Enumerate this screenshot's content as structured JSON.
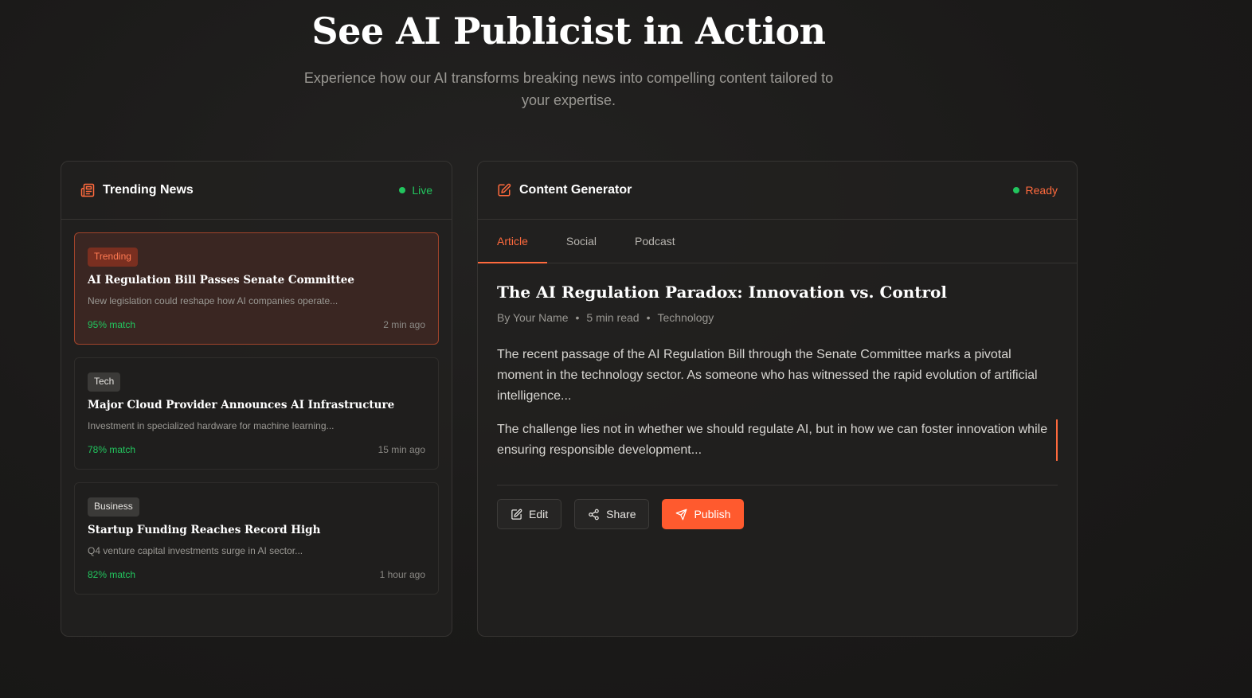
{
  "hero": {
    "title": "See AI Publicist in Action",
    "subtitle": "Experience how our AI transforms breaking news into compelling content tailored to your expertise."
  },
  "news_panel": {
    "title": "Trending News",
    "status": "Live",
    "items": [
      {
        "tag": "Trending",
        "title": "AI Regulation Bill Passes Senate Committee",
        "desc": "New legislation could reshape how AI companies operate...",
        "match": "95% match",
        "time": "2 min ago"
      },
      {
        "tag": "Tech",
        "title": "Major Cloud Provider Announces AI Infrastructure",
        "desc": "Investment in specialized hardware for machine learning...",
        "match": "78% match",
        "time": "15 min ago"
      },
      {
        "tag": "Business",
        "title": "Startup Funding Reaches Record High",
        "desc": "Q4 venture capital investments surge in AI sector...",
        "match": "82% match",
        "time": "1 hour ago"
      }
    ]
  },
  "generator_panel": {
    "title": "Content Generator",
    "status": "Ready",
    "tabs": [
      "Article",
      "Social",
      "Podcast"
    ],
    "article": {
      "title": "The AI Regulation Paradox: Innovation vs. Control",
      "author": "By Your Name",
      "read_time": "5 min read",
      "category": "Technology",
      "sep": "•",
      "para1": "The recent passage of the AI Regulation Bill through the Senate Committee marks a pivotal moment in the technology sector. As someone who has witnessed the rapid evolution of artificial intelligence...",
      "para2": "The challenge lies not in whether we should regulate AI, but in how we can foster innovation while ensuring responsible development..."
    },
    "actions": {
      "edit": "Edit",
      "share": "Share",
      "publish": "Publish"
    }
  },
  "colors": {
    "accent": "#ff5a2e",
    "live": "#22c55e"
  }
}
